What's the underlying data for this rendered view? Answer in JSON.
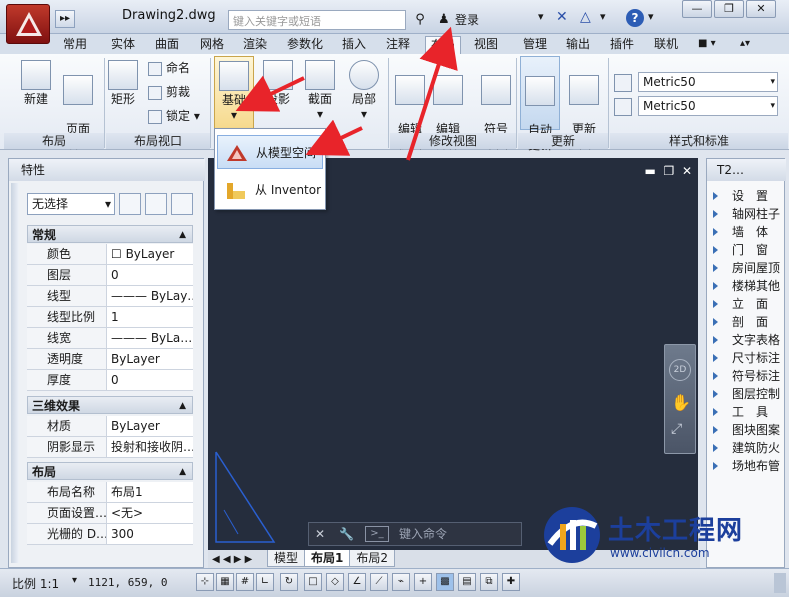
{
  "titlebar": {
    "doc_title": "Drawing2.dwg",
    "search_placeholder": "键入关键字或短语",
    "login": "登录"
  },
  "tabs": [
    "常用",
    "实体",
    "曲面",
    "网格",
    "渲染",
    "参数化",
    "插入",
    "注释",
    "布局",
    "视图",
    "管理",
    "输出",
    "插件",
    "联机"
  ],
  "active_tab": "布局",
  "ribbon": {
    "layout_panel": {
      "new": "新建",
      "page_setup": "页面\n设置",
      "footer": "布局"
    },
    "viewport_panel": {
      "rect": "矩形",
      "name": "命名",
      "clip": "剪裁",
      "lock": "锁定",
      "footer": "布局视口"
    },
    "base": "基础",
    "projected": "投影",
    "section": "截面",
    "detail": "局部",
    "modify_view": {
      "edit_view": "编辑\n视图",
      "edit_comp": "编辑\n部件",
      "symbol_sketch": "符号\n草图",
      "footer": "修改视图"
    },
    "update": {
      "auto_update": "自动\n更新",
      "update_view": "更新\n视图",
      "footer": "更新"
    },
    "styles": {
      "combo1": "Metric50",
      "combo2": "Metric50",
      "footer": "样式和标准"
    }
  },
  "dropdown": {
    "item1": "从模型空间",
    "item2": "从 Inventor"
  },
  "properties": {
    "title": "特性",
    "selection": "无选择",
    "sections": [
      {
        "name": "常规",
        "rows": [
          [
            "颜色",
            "☐ ByLayer"
          ],
          [
            "图层",
            "0"
          ],
          [
            "线型",
            "——— ByLay…"
          ],
          [
            "线型比例",
            "1"
          ],
          [
            "线宽",
            "——— ByLa…"
          ],
          [
            "透明度",
            "ByLayer"
          ],
          [
            "厚度",
            "0"
          ]
        ]
      },
      {
        "name": "三维效果",
        "rows": [
          [
            "材质",
            "ByLayer"
          ],
          [
            "阴影显示",
            "投射和接收阴…"
          ]
        ]
      },
      {
        "name": "布局",
        "rows": [
          [
            "布局名称",
            "布局1"
          ],
          [
            "页面设置…",
            "<无>"
          ],
          [
            "光栅的 D…",
            "300"
          ]
        ]
      }
    ]
  },
  "tool_palette": {
    "title": "T2…",
    "items": [
      "设　置",
      "轴网柱子",
      "墙　体",
      "门　窗",
      "房间屋顶",
      "楼梯其他",
      "立　面",
      "剖　面",
      "文字表格",
      "尺寸标注",
      "符号标注",
      "图层控制",
      "工　具",
      "图块图案",
      "建筑防火",
      "场地布管"
    ]
  },
  "command_line": {
    "placeholder": "键入命令"
  },
  "layout_tabs": [
    "模型",
    "布局1",
    "布局2"
  ],
  "status": {
    "scale": "比例 1:1",
    "coords": "1121, 659, 0"
  },
  "watermark": {
    "name": "土木工程网",
    "url": "www.civilcn.com"
  },
  "colors": {
    "canvas": "#252d3d",
    "annotation_arrow": "#e8242a",
    "brand": "#1c3f9c"
  }
}
